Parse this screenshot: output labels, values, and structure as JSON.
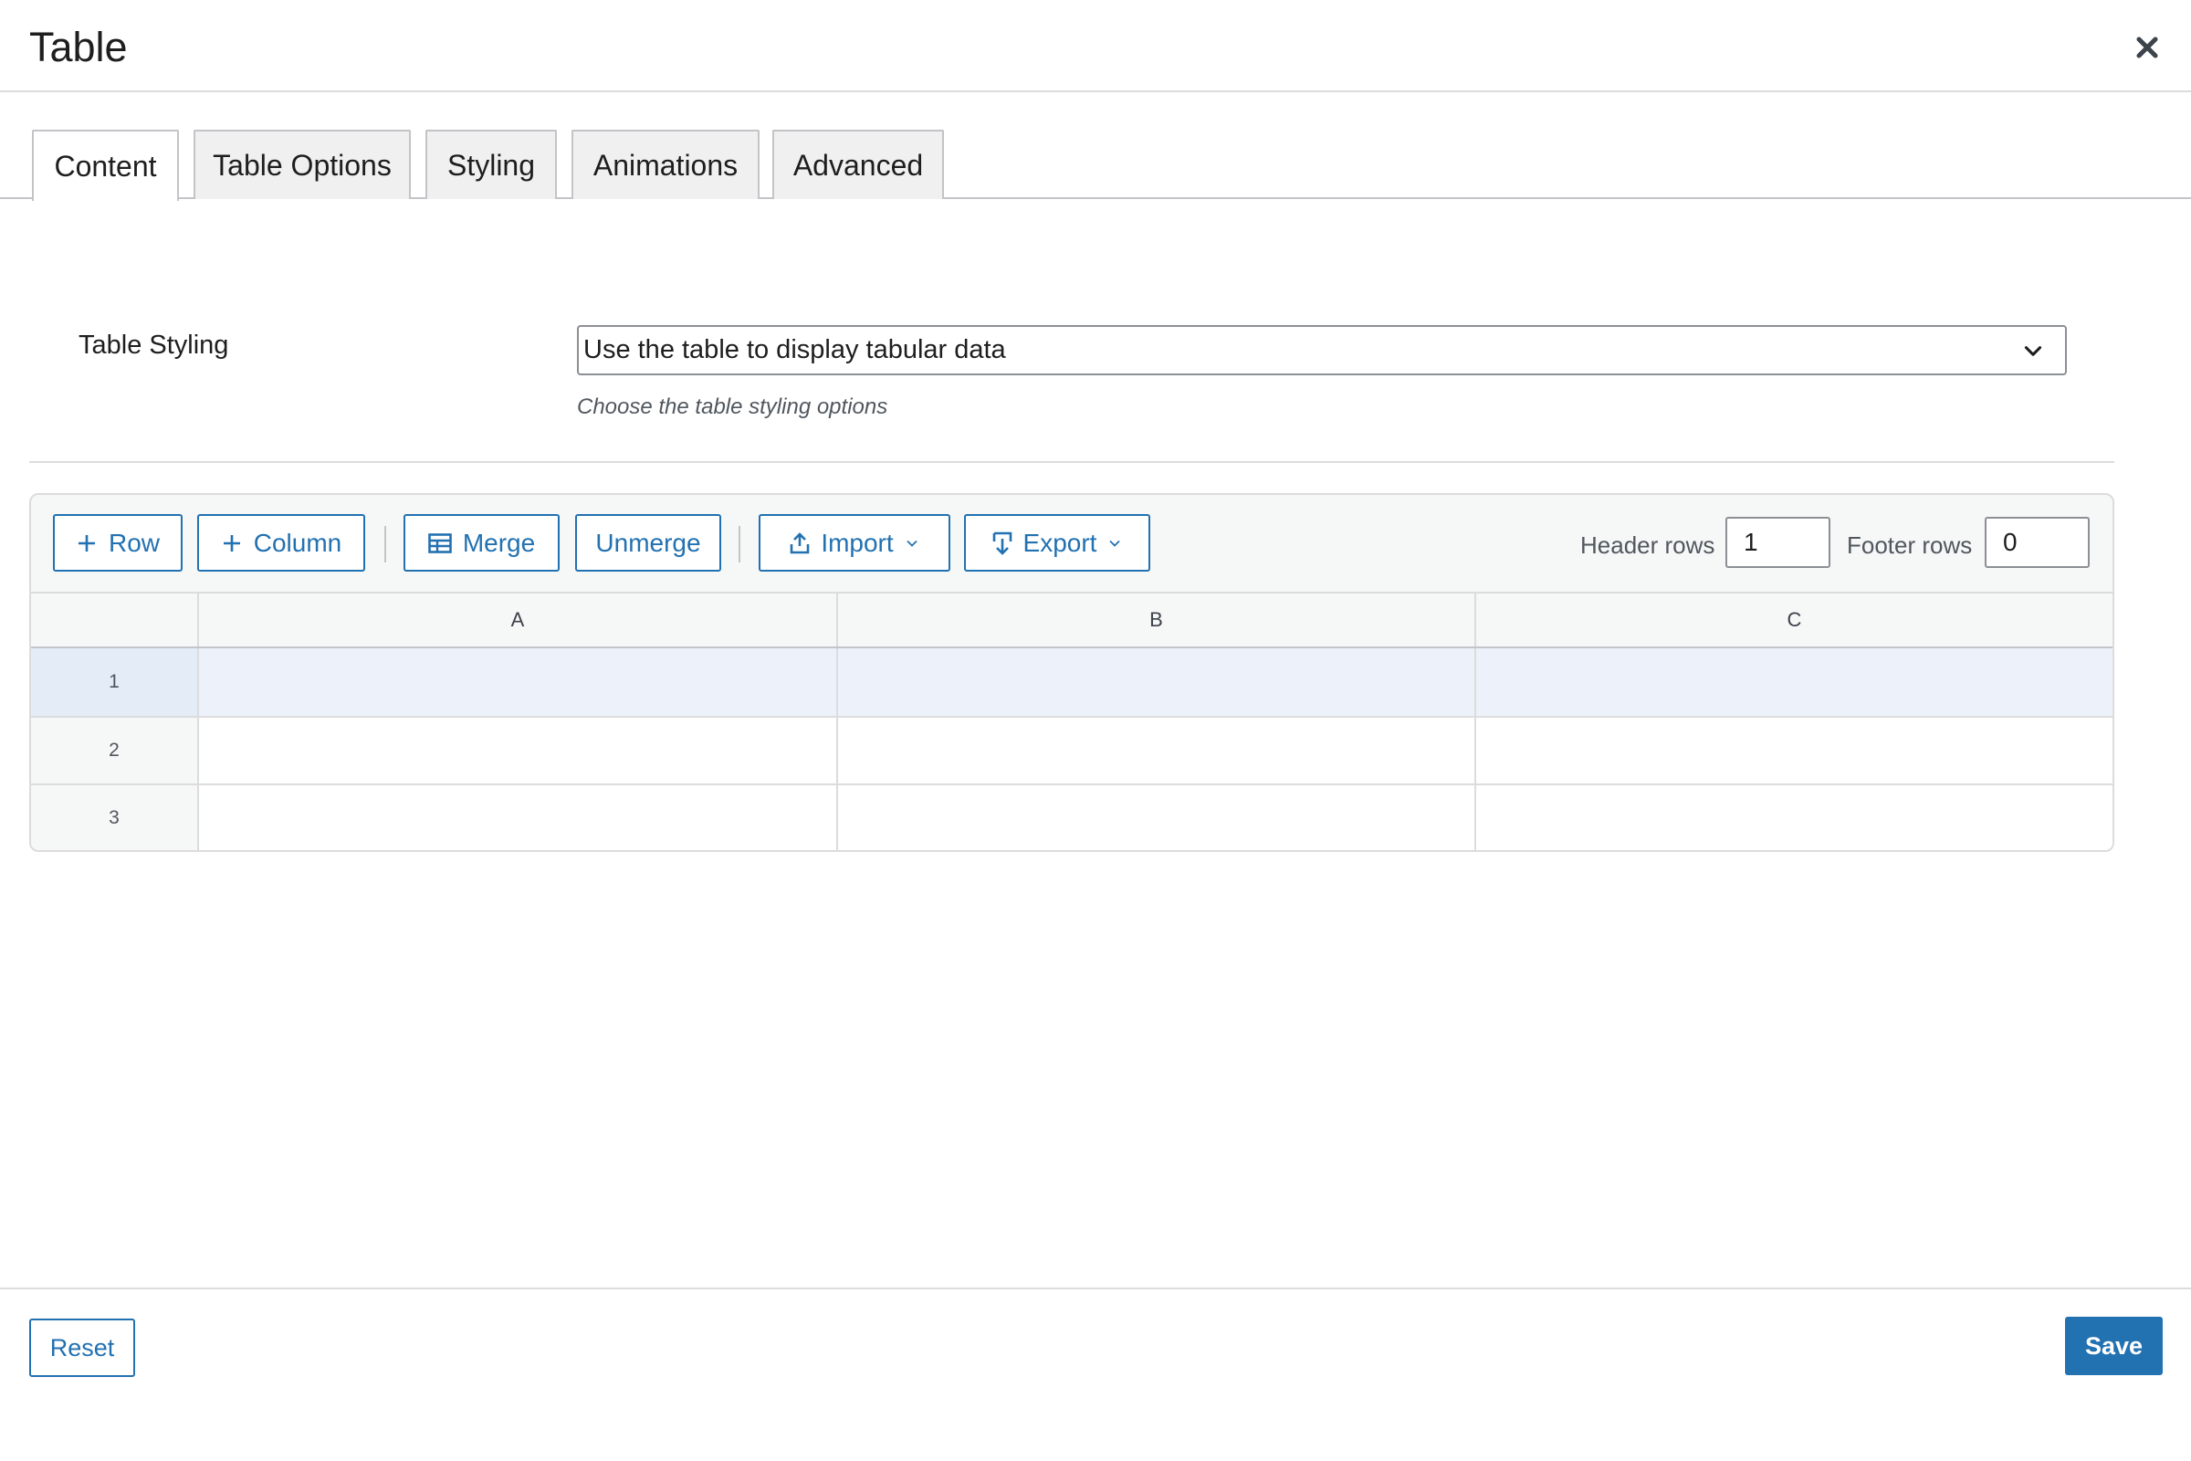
{
  "modal": {
    "title": "Table",
    "close_icon": "close-icon"
  },
  "tabs": [
    {
      "label": "Content",
      "active": true
    },
    {
      "label": "Table Options",
      "active": false
    },
    {
      "label": "Styling",
      "active": false
    },
    {
      "label": "Animations",
      "active": false
    },
    {
      "label": "Advanced",
      "active": false
    }
  ],
  "table_styling": {
    "label": "Table Styling",
    "selected": "Use the table to display tabular data",
    "help": "Choose the table styling options"
  },
  "toolbar": {
    "row_label": "Row",
    "column_label": "Column",
    "merge_label": "Merge",
    "unmerge_label": "Unmerge",
    "import_label": "Import",
    "export_label": "Export",
    "header_rows_label": "Header rows",
    "header_rows_value": "1",
    "footer_rows_label": "Footer rows",
    "footer_rows_value": "0",
    "icons": [
      "plus-icon",
      "plus-icon",
      "table-merge-icon",
      "upload-icon",
      "download-icon",
      "chevron-down-icon"
    ]
  },
  "grid": {
    "columns": [
      "A",
      "B",
      "C"
    ],
    "rows": [
      {
        "number": "1",
        "cells": [
          "",
          "",
          ""
        ]
      },
      {
        "number": "2",
        "cells": [
          "",
          "",
          ""
        ]
      },
      {
        "number": "3",
        "cells": [
          "",
          "",
          ""
        ]
      }
    ]
  },
  "footer": {
    "reset_label": "Reset",
    "save_label": "Save"
  },
  "colors": {
    "accent": "#2271b1",
    "selected_row": "#edf2fa",
    "border": "#dcdcde"
  }
}
